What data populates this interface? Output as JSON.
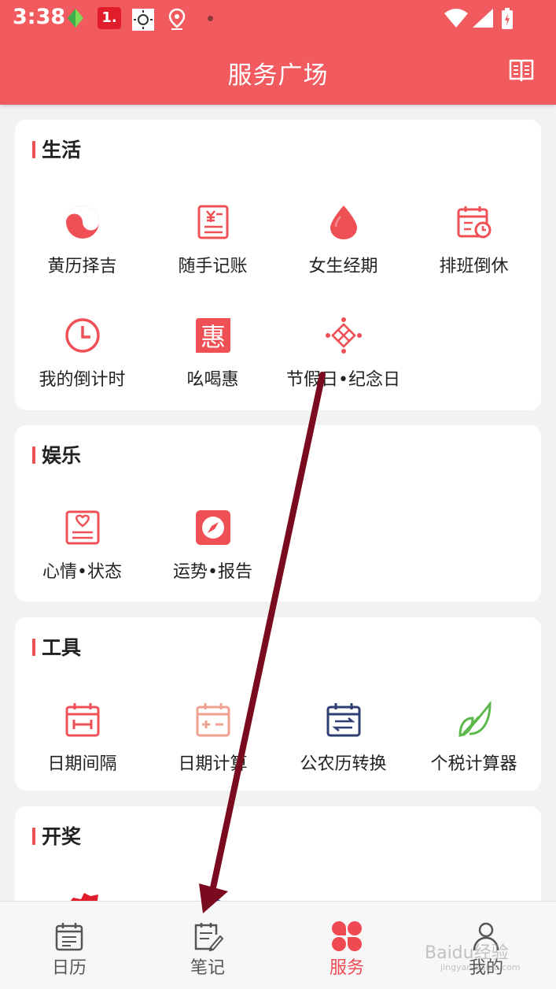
{
  "status_bar": {
    "time": "3:38",
    "notification_badge": "1."
  },
  "header": {
    "title": "服务广场",
    "right_icon": "book-icon"
  },
  "sections": [
    {
      "title": "生活",
      "items": [
        {
          "label": "黄历择吉",
          "icon": "yinyang-icon"
        },
        {
          "label": "随手记账",
          "icon": "ledger-icon"
        },
        {
          "label": "女生经期",
          "icon": "drop-icon"
        },
        {
          "label": "排班倒休",
          "icon": "calendar-clock-icon"
        },
        {
          "label": "我的倒计时",
          "icon": "clock-icon"
        },
        {
          "label": "吆喝惠",
          "icon": "hui-icon"
        },
        {
          "label": "节假日•纪念日",
          "icon": "chinese-knot-icon"
        }
      ]
    },
    {
      "title": "娱乐",
      "items": [
        {
          "label": "心情•状态",
          "icon": "mood-note-icon"
        },
        {
          "label": "运势•报告",
          "icon": "compass-icon"
        }
      ]
    },
    {
      "title": "工具",
      "items": [
        {
          "label": "日期间隔",
          "icon": "date-interval-icon"
        },
        {
          "label": "日期计算",
          "icon": "date-calc-icon"
        },
        {
          "label": "公农历转换",
          "icon": "calendar-convert-icon"
        },
        {
          "label": "个税计算器",
          "icon": "leaf-icon"
        }
      ]
    },
    {
      "title": "开奖",
      "items": []
    }
  ],
  "tabbar": {
    "tabs": [
      {
        "label": "日历",
        "icon": "calendar-icon",
        "active": false
      },
      {
        "label": "笔记",
        "icon": "note-edit-icon",
        "active": false
      },
      {
        "label": "服务",
        "icon": "service-grid-icon",
        "active": true
      },
      {
        "label": "我的",
        "icon": "user-icon",
        "active": false
      }
    ]
  },
  "watermark": {
    "text": "Baidu经验",
    "sub": "jingyan.baidu.com"
  },
  "colors": {
    "brand_red": "#f15a5e",
    "accent_red": "#ef4a52",
    "tool_blue": "#2c3e72",
    "leaf_green": "#5cb84a",
    "annotation_arrow": "#7a0a1e"
  }
}
